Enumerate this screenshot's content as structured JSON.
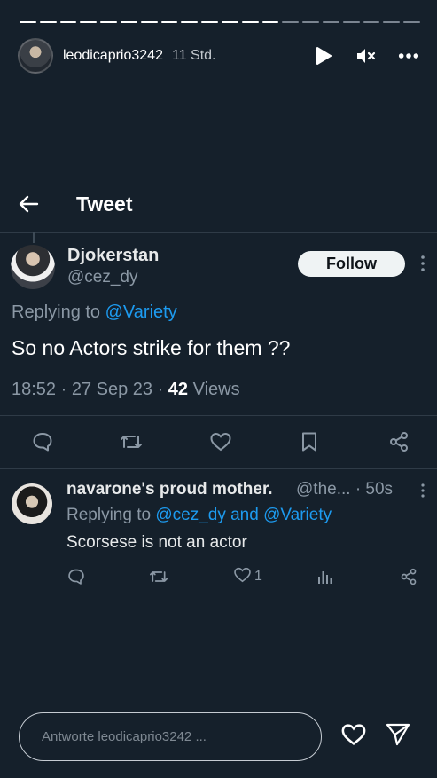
{
  "story": {
    "username": "leodicaprio3242",
    "time": "11 Std.",
    "progress_segments": 20,
    "progress_done": 13,
    "reply_placeholder": "Antworte leodicaprio3242 ..."
  },
  "tweet_page": {
    "title": "Tweet"
  },
  "tweet": {
    "display_name": "Djokerstan",
    "handle": "@cez_dy",
    "follow_label": "Follow",
    "replying_prefix": "Replying to",
    "replying_to": "@Variety",
    "text": "So no Actors strike for them ??",
    "timestamp": "18:52 · 27 Sep 23 · ",
    "views_count": "42",
    "views_label": " Views"
  },
  "reply": {
    "display_name": "navarone's proud mother.",
    "handle_time": "@the... · 50s",
    "replying_prefix": "Replying to",
    "replying_to": "@cez_dy and @Variety",
    "text": "Scorsese is not an actor",
    "like_count": "1"
  },
  "colors": {
    "background": "#15202b",
    "accent": "#1d9bf0",
    "muted": "#8b98a5"
  }
}
